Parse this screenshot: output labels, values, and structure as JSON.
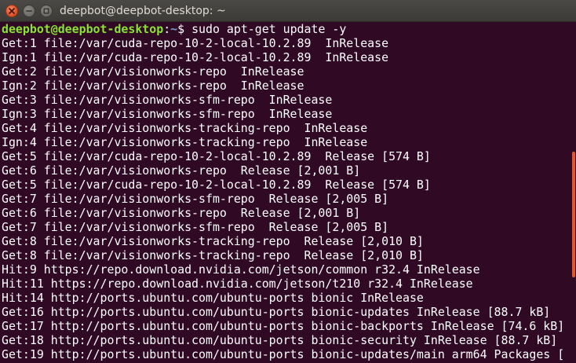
{
  "window": {
    "title": "deepbot@deepbot-desktop: ~",
    "accent_color": "#e95420",
    "background_color": "#300a24",
    "controls": {
      "close_icon": "close-icon",
      "minimize_icon": "minimize-icon",
      "maximize_icon": "maximize-icon"
    }
  },
  "terminal": {
    "prompt": {
      "user_host": "deepbot@deepbot-desktop",
      "colon": ":",
      "path": "~",
      "dollar": "$ ",
      "command": "sudo apt-get update -y"
    },
    "lines": [
      "Get:1 file:/var/cuda-repo-10-2-local-10.2.89  InRelease",
      "Ign:1 file:/var/cuda-repo-10-2-local-10.2.89  InRelease",
      "Get:2 file:/var/visionworks-repo  InRelease",
      "Ign:2 file:/var/visionworks-repo  InRelease",
      "Get:3 file:/var/visionworks-sfm-repo  InRelease",
      "Ign:3 file:/var/visionworks-sfm-repo  InRelease",
      "Get:4 file:/var/visionworks-tracking-repo  InRelease",
      "Ign:4 file:/var/visionworks-tracking-repo  InRelease",
      "Get:5 file:/var/cuda-repo-10-2-local-10.2.89  Release [574 B]",
      "Get:6 file:/var/visionworks-repo  Release [2,001 B]",
      "Get:5 file:/var/cuda-repo-10-2-local-10.2.89  Release [574 B]",
      "Get:7 file:/var/visionworks-sfm-repo  Release [2,005 B]",
      "Get:6 file:/var/visionworks-repo  Release [2,001 B]",
      "Get:7 file:/var/visionworks-sfm-repo  Release [2,005 B]",
      "Get:8 file:/var/visionworks-tracking-repo  Release [2,010 B]",
      "Get:8 file:/var/visionworks-tracking-repo  Release [2,010 B]",
      "Hit:9 https://repo.download.nvidia.com/jetson/common r32.4 InRelease",
      "Hit:11 https://repo.download.nvidia.com/jetson/t210 r32.4 InRelease",
      "Hit:14 http://ports.ubuntu.com/ubuntu-ports bionic InRelease",
      "Get:16 http://ports.ubuntu.com/ubuntu-ports bionic-updates InRelease [88.7 kB]",
      "Get:17 http://ports.ubuntu.com/ubuntu-ports bionic-backports InRelease [74.6 kB]",
      "Get:18 http://ports.ubuntu.com/ubuntu-ports bionic-security InRelease [88.7 kB]",
      "Get:19 http://ports.ubuntu.com/ubuntu-ports bionic-updates/main arm64 Packages ["
    ]
  }
}
